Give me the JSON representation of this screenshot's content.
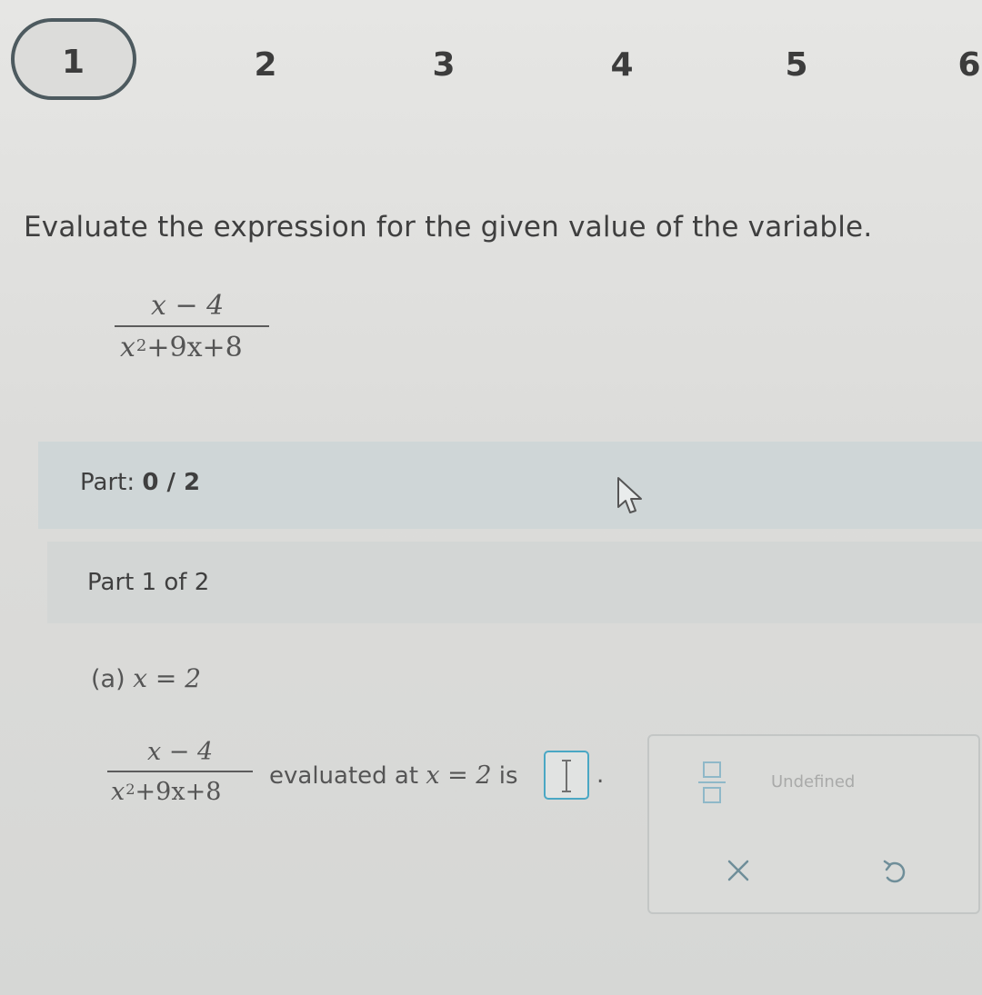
{
  "steps": {
    "items": [
      "1",
      "2",
      "3",
      "4",
      "5",
      "6"
    ],
    "current": "1"
  },
  "question": {
    "prompt": "Evaluate the expression for the given value of the variable.",
    "expression": {
      "numerator": "x − 4",
      "denominator_base": "x",
      "denominator_exp": "2",
      "denominator_rest": "+9x+8"
    }
  },
  "part_header": {
    "label": "Part:",
    "count": "0 / 2"
  },
  "part_sub": {
    "label": "Part 1 of 2"
  },
  "subquestion": {
    "label": "(a)",
    "condition": "x = 2"
  },
  "answer": {
    "expression": {
      "numerator": "x − 4",
      "denominator_base": "x",
      "denominator_exp": "2",
      "denominator_rest": "+9x+8"
    },
    "text_before": "evaluated at",
    "condition": "x = 2",
    "text_after": "is",
    "period": ".",
    "value": ""
  },
  "palette": {
    "fraction_icon": "fraction-template-icon",
    "undefined_label": "Undefined",
    "clear_icon": "x-icon",
    "undo_icon": "undo-icon",
    "accent_color": "#4aa7c4"
  }
}
